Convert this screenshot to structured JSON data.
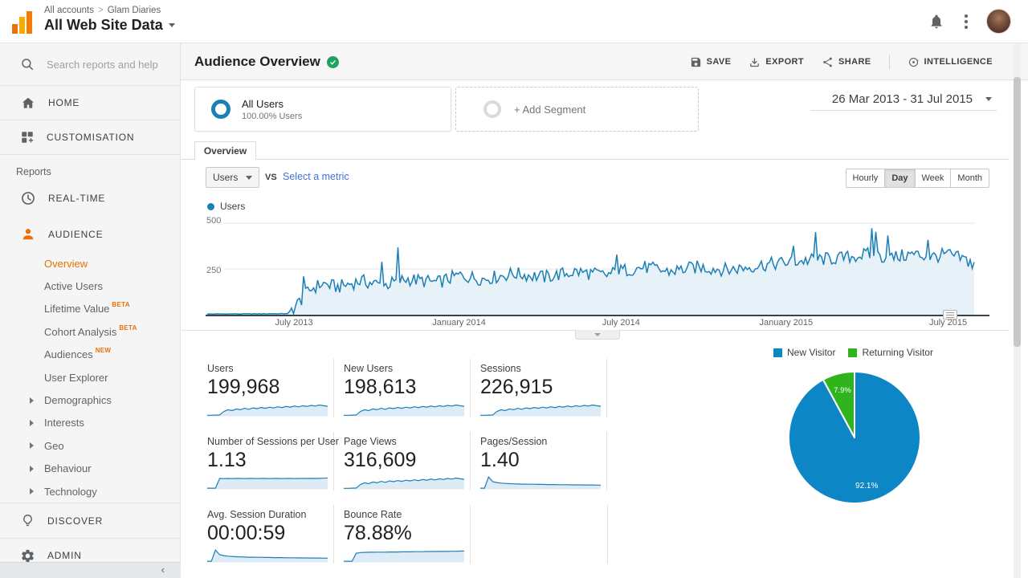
{
  "topbar": {
    "breadcrumb": [
      "All accounts",
      "Glam Diaries"
    ],
    "view_title": "All Web Site Data"
  },
  "sidebar": {
    "search_placeholder": "Search reports and help",
    "home_label": "HOME",
    "customisation_label": "CUSTOMISATION",
    "reports_label": "Reports",
    "realtime_label": "REAL-TIME",
    "audience_label": "AUDIENCE",
    "audience_children": [
      {
        "label": "Overview",
        "active": true
      },
      {
        "label": "Active Users"
      },
      {
        "label": "Lifetime Value",
        "badge": "BETA"
      },
      {
        "label": "Cohort Analysis",
        "badge": "BETA"
      },
      {
        "label": "Audiences",
        "badge": "NEW"
      },
      {
        "label": "User Explorer"
      },
      {
        "label": "Demographics",
        "expand": true
      },
      {
        "label": "Interests",
        "expand": true
      },
      {
        "label": "Geo",
        "expand": true
      },
      {
        "label": "Behaviour",
        "expand": true
      },
      {
        "label": "Technology",
        "expand": true
      }
    ],
    "discover_label": "DISCOVER",
    "admin_label": "ADMIN"
  },
  "report": {
    "title": "Audience Overview",
    "toolbar": {
      "save": "SAVE",
      "export": "EXPORT",
      "share": "SHARE",
      "intelligence": "INTELLIGENCE"
    },
    "date_range": "26 Mar 2013 - 31 Jul 2015",
    "segment": {
      "name": "All Users",
      "detail": "100.00% Users"
    },
    "add_segment": "+ Add Segment",
    "tab": "Overview",
    "metric_selector": "Users",
    "vs_label": "VS",
    "compare_link": "Select a metric",
    "granularity": [
      "Hourly",
      "Day",
      "Week",
      "Month"
    ],
    "granularity_selected": "Day",
    "legend_series": "Users"
  },
  "chart_data": {
    "timeseries": {
      "type": "area",
      "series": "Users",
      "x_ticks": [
        "July 2013",
        "January 2014",
        "July 2014",
        "January 2015",
        "July 2015"
      ],
      "x_tick_t": [
        0.113,
        0.328,
        0.539,
        0.754,
        0.965
      ],
      "y_tick_labels": [
        "500",
        "250"
      ],
      "ylim": [
        0,
        500
      ],
      "grid": true,
      "line_color": "#1c7fb5",
      "fill_color": "#e6f1f8",
      "anchors": [
        [
          0,
          2
        ],
        [
          0.06,
          3
        ],
        [
          0.105,
          4
        ],
        [
          0.118,
          60
        ],
        [
          0.135,
          140
        ],
        [
          0.15,
          170
        ],
        [
          0.17,
          150
        ],
        [
          0.2,
          185
        ],
        [
          0.23,
          160
        ],
        [
          0.26,
          195
        ],
        [
          0.3,
          175
        ],
        [
          0.328,
          215
        ],
        [
          0.36,
          195
        ],
        [
          0.4,
          225
        ],
        [
          0.44,
          205
        ],
        [
          0.48,
          235
        ],
        [
          0.52,
          215
        ],
        [
          0.539,
          240
        ],
        [
          0.57,
          260
        ],
        [
          0.6,
          235
        ],
        [
          0.64,
          260
        ],
        [
          0.68,
          245
        ],
        [
          0.72,
          270
        ],
        [
          0.754,
          285
        ],
        [
          0.79,
          300
        ],
        [
          0.83,
          310
        ],
        [
          0.86,
          330
        ],
        [
          0.89,
          310
        ],
        [
          0.92,
          330
        ],
        [
          0.945,
          315
        ],
        [
          0.965,
          330
        ],
        [
          0.98,
          310
        ],
        [
          0.995,
          290
        ],
        [
          1,
          235
        ]
      ]
    },
    "scorecards": [
      {
        "label": "Users",
        "value": "199,968",
        "spark": "rise",
        "row": 0
      },
      {
        "label": "New Users",
        "value": "198,613",
        "spark": "rise",
        "row": 0
      },
      {
        "label": "Sessions",
        "value": "226,915",
        "spark": "rise",
        "row": 0
      },
      {
        "label": "Number of Sessions per User",
        "value": "1.13",
        "spark": "step_flat",
        "row": 1
      },
      {
        "label": "Page Views",
        "value": "316,609",
        "spark": "rise",
        "row": 1
      },
      {
        "label": "Pages/Session",
        "value": "1.40",
        "spark": "spike_decay",
        "row": 1
      },
      {
        "label": "Avg. Session Duration",
        "value": "00:00:59",
        "spark": "spike_decay",
        "row": 2
      },
      {
        "label": "Bounce Rate",
        "value": "78.88%",
        "spark": "step_rise",
        "row": 2
      }
    ],
    "sparklines": {
      "rise": [
        0.04,
        0.04,
        0.05,
        0.06,
        0.3,
        0.42,
        0.36,
        0.48,
        0.42,
        0.52,
        0.45,
        0.55,
        0.5,
        0.58,
        0.52,
        0.6,
        0.55,
        0.63,
        0.57,
        0.65,
        0.6,
        0.68,
        0.62,
        0.7,
        0.65,
        0.72,
        0.68,
        0.75,
        0.7,
        0.66
      ],
      "step_flat": [
        0.05,
        0.05,
        0.05,
        0.72,
        0.71,
        0.72,
        0.71,
        0.72,
        0.72,
        0.71,
        0.72,
        0.72,
        0.71,
        0.72,
        0.72,
        0.71,
        0.72,
        0.72,
        0.71,
        0.72,
        0.72,
        0.71,
        0.72,
        0.72,
        0.72,
        0.73,
        0.72,
        0.73,
        0.74,
        0.76
      ],
      "spike_decay": [
        0.05,
        0.05,
        0.82,
        0.5,
        0.44,
        0.4,
        0.38,
        0.36,
        0.35,
        0.34,
        0.33,
        0.33,
        0.32,
        0.32,
        0.31,
        0.31,
        0.3,
        0.3,
        0.3,
        0.29,
        0.29,
        0.29,
        0.28,
        0.28,
        0.28,
        0.27,
        0.27,
        0.27,
        0.26,
        0.26
      ],
      "step_rise": [
        0.05,
        0.05,
        0.05,
        0.6,
        0.65,
        0.66,
        0.67,
        0.67,
        0.68,
        0.68,
        0.68,
        0.69,
        0.69,
        0.69,
        0.7,
        0.7,
        0.7,
        0.71,
        0.71,
        0.71,
        0.72,
        0.72,
        0.72,
        0.73,
        0.73,
        0.73,
        0.74,
        0.74,
        0.75,
        0.76
      ]
    },
    "pie": {
      "type": "pie",
      "labels": [
        "New Visitor",
        "Returning Visitor"
      ],
      "values": [
        92.1,
        7.9
      ],
      "value_labels": [
        "92.1%",
        "7.9%"
      ],
      "colors": [
        "#0d86c6",
        "#2fb41e"
      ]
    }
  }
}
